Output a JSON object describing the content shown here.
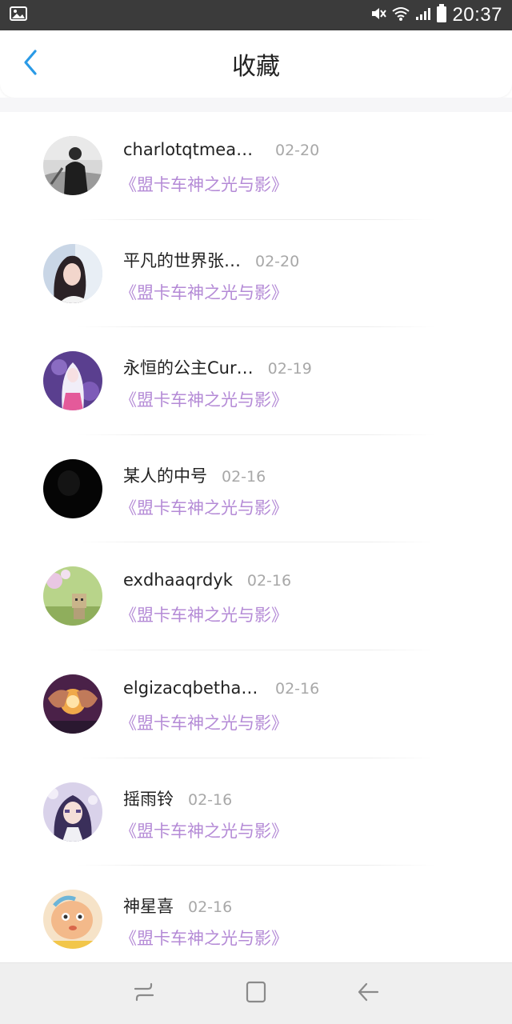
{
  "status_bar": {
    "time": "20:37",
    "icons": [
      "image-icon",
      "mute-icon",
      "wifi-icon",
      "signal-icon",
      "battery-icon"
    ]
  },
  "header": {
    "title": "收藏",
    "back_icon": "chevron-left-icon"
  },
  "colors": {
    "accent": "#2a9ae6",
    "book_title": "#b48ad6",
    "date": "#a8a8a8",
    "name": "#222222"
  },
  "favorites": [
    {
      "name": "charlotqtmeaol…",
      "date": "02-20",
      "book": "《盟卡车神之光与影》",
      "avatar": "avatar-bw-man"
    },
    {
      "name": "平凡的世界张…",
      "date": "02-20",
      "book": "《盟卡车神之光与影》",
      "avatar": "avatar-girl"
    },
    {
      "name": "永恒的公主Cur…",
      "date": "02-19",
      "book": "《盟卡车神之光与影》",
      "avatar": "avatar-anime-white"
    },
    {
      "name": "某人的中号",
      "date": "02-16",
      "book": "《盟卡车神之光与影》",
      "avatar": "avatar-black"
    },
    {
      "name": "exdhaaqrdyk",
      "date": "02-16",
      "book": "《盟卡车神之光与影》",
      "avatar": "avatar-green-robot"
    },
    {
      "name": "elgizacqbethan…",
      "date": "02-16",
      "book": "《盟卡车神之光与影》",
      "avatar": "avatar-heart-hands"
    },
    {
      "name": "摇雨铃",
      "date": "02-16",
      "book": "《盟卡车神之光与影》",
      "avatar": "avatar-anime-purple"
    },
    {
      "name": "神星喜",
      "date": "02-16",
      "book": "《盟卡车神之光与影》",
      "avatar": "avatar-cartoon"
    }
  ],
  "nav_bar": {
    "buttons": [
      "recent-apps-icon",
      "home-icon",
      "back-icon"
    ]
  }
}
